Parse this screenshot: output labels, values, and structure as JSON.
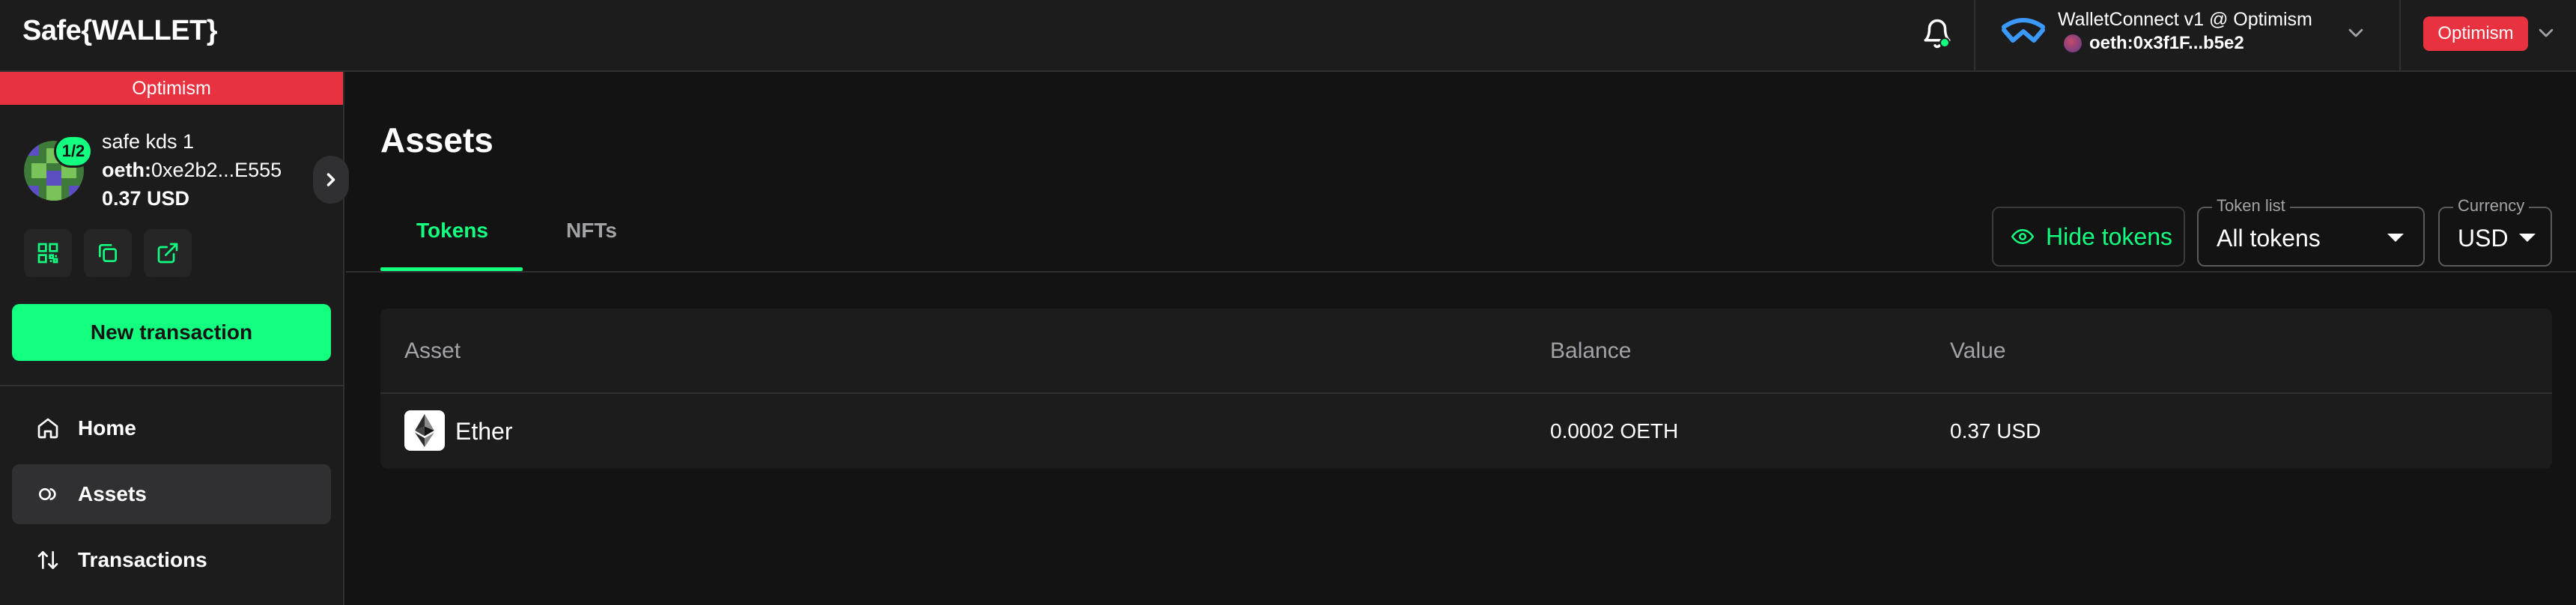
{
  "header": {
    "logo": "Safe{WALLET}",
    "wallet_connect": {
      "title": "WalletConnect v1 @ Optimism",
      "address_prefix": "oeth:",
      "address": "0x3f1F...b5e2"
    },
    "network_badge": "Optimism"
  },
  "sidebar": {
    "network_banner": "Optimism",
    "safe": {
      "threshold": "1/2",
      "name": "safe kds 1",
      "address_prefix": "oeth:",
      "address": "0xe2b2...E555",
      "balance": "0.37 USD"
    },
    "new_transaction_label": "New transaction",
    "nav": [
      {
        "label": "Home",
        "icon": "home-icon"
      },
      {
        "label": "Assets",
        "icon": "assets-icon",
        "active": true
      },
      {
        "label": "Transactions",
        "icon": "transactions-icon"
      }
    ]
  },
  "main": {
    "title": "Assets",
    "tabs": [
      {
        "label": "Tokens",
        "active": true
      },
      {
        "label": "NFTs"
      }
    ],
    "hide_tokens_label": "Hide tokens",
    "token_list": {
      "label": "Token list",
      "value": "All tokens"
    },
    "currency": {
      "label": "Currency",
      "value": "USD"
    },
    "table": {
      "headers": [
        "Asset",
        "Balance",
        "Value"
      ],
      "rows": [
        {
          "asset": "Ether",
          "balance": "0.0002 OETH",
          "value": "0.37 USD"
        }
      ]
    }
  },
  "colors": {
    "accent": "#12ff80",
    "network": "#e8323f",
    "background": "#121312",
    "surface": "#1c1c1c"
  }
}
